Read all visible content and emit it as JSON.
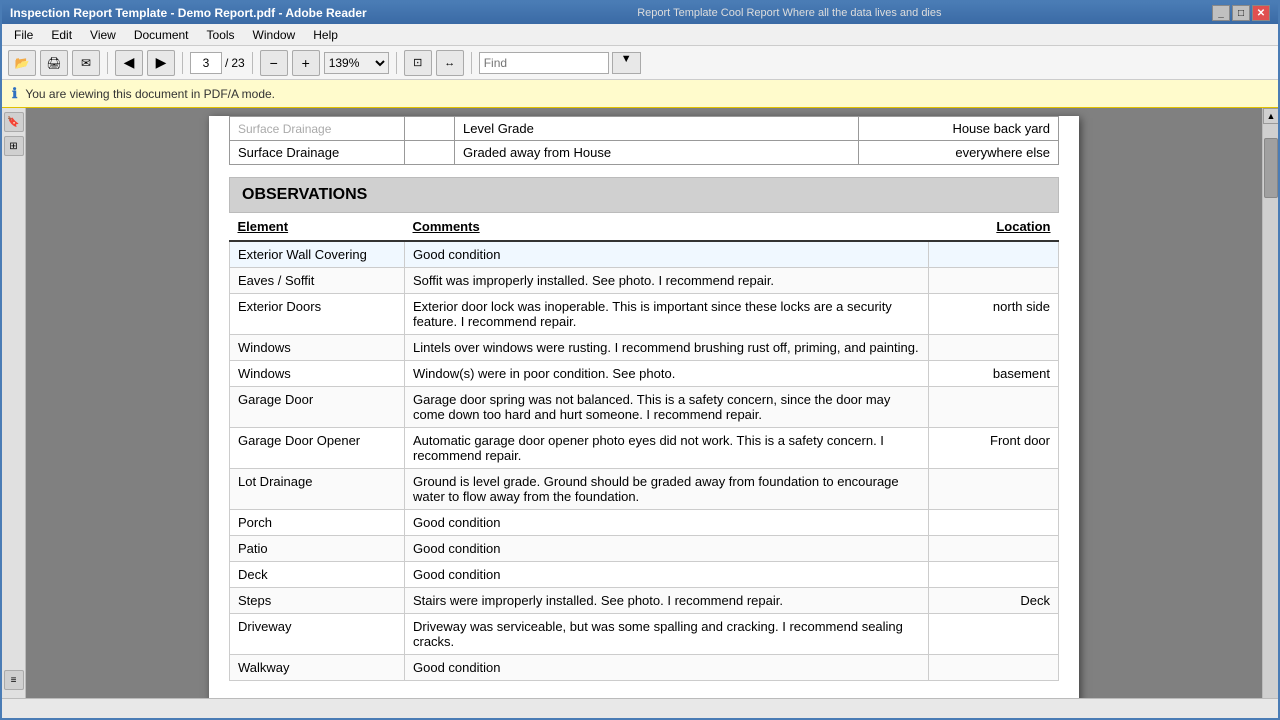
{
  "window": {
    "title": "Inspection Report Template - Demo Report.pdf - Adobe Reader",
    "title_right": "Report Template    Cool Report    Where all the data lives and dies"
  },
  "menu": {
    "items": [
      "File",
      "Edit",
      "View",
      "Document",
      "Tools",
      "Window",
      "Help"
    ]
  },
  "toolbar": {
    "page_current": "3",
    "page_total": "23",
    "zoom": "139%",
    "find_placeholder": "Find"
  },
  "notification": {
    "text": "You are viewing this document in PDF/A mode."
  },
  "top_table": {
    "rows": [
      {
        "col1": "Surface Drainage",
        "col2": "",
        "col3": "Level Grade",
        "col4": "House back yard"
      },
      {
        "col1": "Surface Drainage",
        "col2": "",
        "col3": "Graded away from House",
        "col4": "everywhere else"
      }
    ]
  },
  "observations_section": {
    "header": "OBSERVATIONS",
    "columns": {
      "element": "Element",
      "comments": "Comments",
      "location": "Location"
    },
    "rows": [
      {
        "element": "Exterior Wall Covering",
        "comments": "Good condition",
        "location": ""
      },
      {
        "element": "Eaves / Soffit",
        "comments": "Soffit was improperly installed.  See photo.  I recommend repair.",
        "location": ""
      },
      {
        "element": "Exterior Doors",
        "comments": "Exterior door lock was inoperable.  This is important since these locks are a security feature.  I recommend repair.",
        "location": "north side"
      },
      {
        "element": "Windows",
        "comments": "Lintels over windows were rusting.  I recommend brushing rust off, priming, and painting.",
        "location": ""
      },
      {
        "element": "Windows",
        "comments": "Window(s) were in poor condition.  See photo.",
        "location": "basement"
      },
      {
        "element": "Garage Door",
        "comments": "Garage door spring was not balanced.  This is a safety concern, since the door may come down too hard and hurt someone.  I recommend repair.",
        "location": ""
      },
      {
        "element": "Garage Door Opener",
        "comments": "Automatic garage door opener photo eyes did not work.  This is a safety concern.  I recommend repair.",
        "location": "Front door"
      },
      {
        "element": "Lot Drainage",
        "comments": "Ground is level grade.  Ground should be graded away from foundation to encourage water to flow away from the foundation.",
        "location": ""
      },
      {
        "element": "Porch",
        "comments": "Good condition",
        "location": ""
      },
      {
        "element": "Patio",
        "comments": "Good condition",
        "location": ""
      },
      {
        "element": "Deck",
        "comments": "Good condition",
        "location": ""
      },
      {
        "element": "Steps",
        "comments": "Stairs were improperly installed.  See photo.  I recommend repair.",
        "location": "Deck"
      },
      {
        "element": "Driveway",
        "comments": "Driveway was serviceable, but was some spalling and cracking.  I recommend sealing cracks.",
        "location": ""
      },
      {
        "element": "Walkway",
        "comments": "Good condition",
        "location": ""
      }
    ]
  },
  "icons": {
    "back": "◀",
    "forward": "▶",
    "scroll_up": "▲",
    "scroll_down": "▼",
    "info": "ℹ",
    "open": "📂",
    "print": "🖨",
    "zoom_in": "+",
    "zoom_out": "-",
    "fit": "⊡",
    "bookmark": "🔖",
    "thumbs": "⊞"
  },
  "status_bar": {
    "text": ""
  }
}
